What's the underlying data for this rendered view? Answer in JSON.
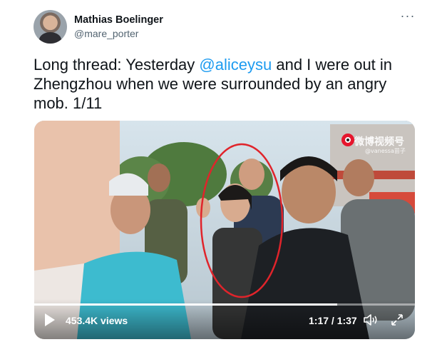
{
  "author": {
    "display_name": "Mathias Boelinger",
    "handle": "@mare_porter"
  },
  "more_options": "···",
  "tweet": {
    "text_1": "Long thread: Yesterday ",
    "mention": "@aliceysu",
    "text_2": " and I were out in Zhengzhou when we were surrounded by an angry mob. 1/11"
  },
  "video": {
    "views": "453.4K views",
    "time": "1:17 / 1:37",
    "progress": 0.795,
    "watermark_text": "微博视频号",
    "watermark_sub": "@vanessa苗子",
    "play_icon": "play-icon",
    "volume_icon": "volume-icon",
    "fullscreen_icon": "fullscreen-icon"
  },
  "colors": {
    "link": "#1d9bf0",
    "text": "#0f1419",
    "secondary": "#536471",
    "annotation_circle": "#e0242b"
  }
}
